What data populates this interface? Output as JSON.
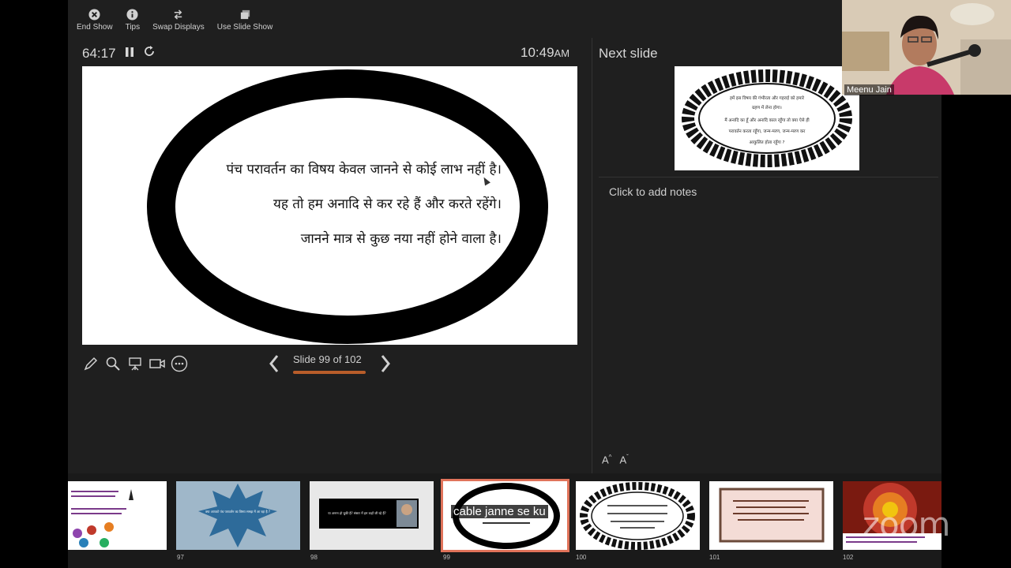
{
  "toolbar": {
    "end_show": "End Show",
    "tips": "Tips",
    "swap_displays": "Swap Displays",
    "use_slide_show": "Use Slide Show"
  },
  "presenter": {
    "elapsed": "64:17",
    "clock_time": "10:49",
    "clock_ampm": "AM"
  },
  "current_slide": {
    "lines": [
      "पंच परावर्तन का विषय केवल जानने से कोई लाभ नहीं है।",
      "यह तो हम अनादि से कर रहे हैं और करते रहेंगे।",
      "जानने मात्र से कुछ नया नहीं होने वाला है।"
    ]
  },
  "navigation": {
    "slide_label": "Slide 99 of 102",
    "progress_fraction": 0.97
  },
  "next_panel": {
    "title": "Next slide",
    "notes_placeholder": "Click to add notes",
    "thumb_lines": [
      "हमें इस विषय की गंभीरता और गहराई को हमारे",
      "ग्रहण में लेना होगा।",
      "मैं अनादि का हूँ और अनादि काल रहूँगा तो क्या ऐसे ही",
      "परावर्तन करता रहूँगा, जन्म-मरण, जन्म-मरण कर",
      "आकुलित होता रहूँगा ?"
    ]
  },
  "font_buttons": {
    "increase": "A",
    "decrease": "A"
  },
  "strip": {
    "numbers": [
      "97",
      "98",
      "99",
      "100",
      "101",
      "102"
    ],
    "t98_text": "या अनन्त हो चुकी है? संसार में हम कहाँ जी रहे हैं?",
    "t97_text": "क्या आपको पंच परावर्तन का विषय समझ में आ रहा है ?"
  },
  "caption": "cable janne se ku",
  "participant": {
    "name": "Meenu Jain"
  },
  "watermark": "zoom",
  "colors": {
    "accent": "#b85d2a",
    "selected_outline": "#e0735a"
  }
}
